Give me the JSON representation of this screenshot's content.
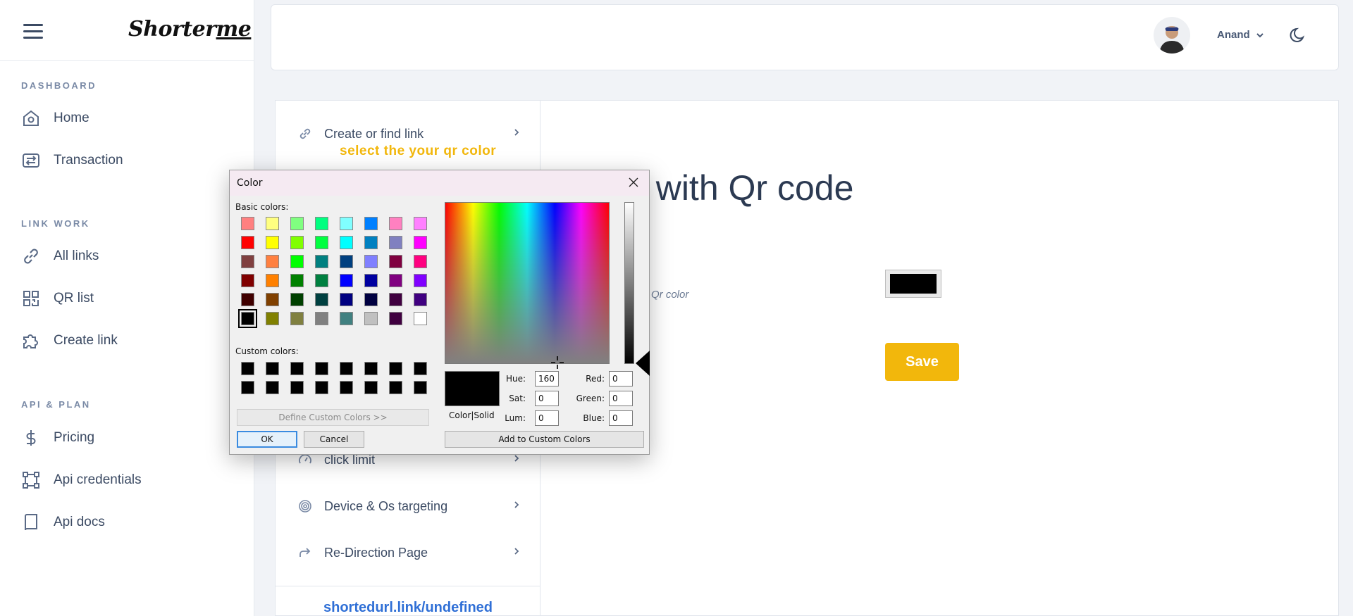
{
  "sidebar": {
    "logo": {
      "main": "Shorterme",
      "underlined": "me",
      "prefix": "Shorter"
    },
    "sections": [
      {
        "label": "DASHBOARD"
      },
      {
        "label": "LINK WORK"
      },
      {
        "label": "API & PLAN"
      }
    ],
    "items": [
      {
        "label": "Home",
        "icon": "home-icon"
      },
      {
        "label": "Transaction",
        "icon": "transaction-icon"
      },
      {
        "label": "All links",
        "icon": "link-icon"
      },
      {
        "label": "QR list",
        "icon": "qr-icon"
      },
      {
        "label": "Create link",
        "icon": "puzzle-icon"
      },
      {
        "label": "Pricing",
        "icon": "dollar-icon"
      },
      {
        "label": "Api credentials",
        "icon": "network-icon"
      },
      {
        "label": "Api docs",
        "icon": "book-icon"
      }
    ]
  },
  "topbar": {
    "user_name": "Anand"
  },
  "steps_menu": {
    "items": [
      {
        "label": "Create or find link"
      },
      {
        "label": "click limit"
      },
      {
        "label": "Device & Os targeting"
      },
      {
        "label": "Re-Direction Page"
      }
    ],
    "hint": "select the your qr color",
    "short_url": "shortedurl.link/undefined"
  },
  "main": {
    "heading": "ate a Link with Qr code",
    "qr_color_label": "Qr color",
    "current_color": "#000000",
    "save_label": "Save"
  },
  "color_dialog": {
    "title": "Color",
    "basic_colors_label": "Basic colors:",
    "custom_colors_label": "Custom colors:",
    "basic_colors": [
      "#ff8080",
      "#ffff80",
      "#80ff80",
      "#00ff80",
      "#80ffff",
      "#0080ff",
      "#ff80c0",
      "#ff80ff",
      "#ff0000",
      "#ffff00",
      "#80ff00",
      "#00ff40",
      "#00ffff",
      "#0080c0",
      "#8080c0",
      "#ff00ff",
      "#804040",
      "#ff8040",
      "#00ff00",
      "#008080",
      "#004080",
      "#8080ff",
      "#800040",
      "#ff0080",
      "#800000",
      "#ff8000",
      "#008000",
      "#008040",
      "#0000ff",
      "#0000a0",
      "#800080",
      "#8000ff",
      "#400000",
      "#804000",
      "#004000",
      "#004040",
      "#000080",
      "#000040",
      "#400040",
      "#400080",
      "#000000",
      "#808000",
      "#808040",
      "#808080",
      "#408080",
      "#c0c0c0",
      "#400040",
      "#ffffff"
    ],
    "selected_index": 40,
    "custom_colors": [
      "#000000",
      "#000000",
      "#000000",
      "#000000",
      "#000000",
      "#000000",
      "#000000",
      "#000000",
      "#000000",
      "#000000",
      "#000000",
      "#000000",
      "#000000",
      "#000000",
      "#000000",
      "#000000"
    ],
    "define_custom_label": "Define Custom Colors >>",
    "ok_label": "OK",
    "cancel_label": "Cancel",
    "add_custom_label": "Add to Custom Colors",
    "preview_label": "Color|Solid",
    "fields": {
      "hue_label": "Hue:",
      "hue": "160",
      "sat_label": "Sat:",
      "sat": "0",
      "lum_label": "Lum:",
      "lum": "0",
      "red_label": "Red:",
      "red": "0",
      "green_label": "Green:",
      "green": "0",
      "blue_label": "Blue:",
      "blue": "0"
    }
  }
}
